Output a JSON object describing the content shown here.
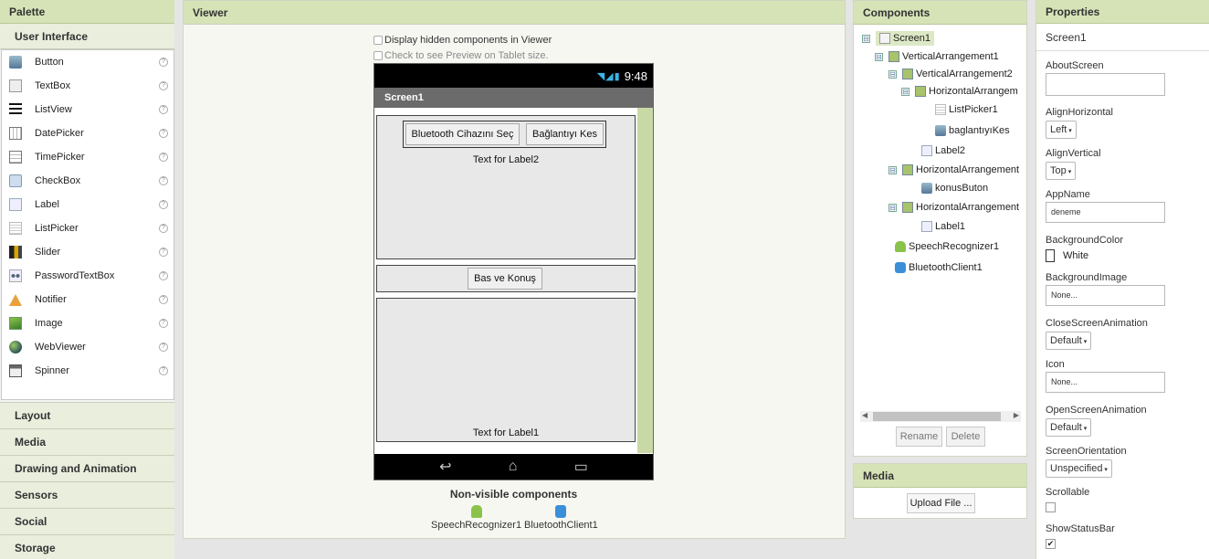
{
  "palette": {
    "title": "Palette",
    "open_category": "User Interface",
    "items": [
      {
        "label": "Button",
        "icon": "button-icon"
      },
      {
        "label": "TextBox",
        "icon": "textbox-icon"
      },
      {
        "label": "ListView",
        "icon": "listview-icon"
      },
      {
        "label": "DatePicker",
        "icon": "datepicker-icon"
      },
      {
        "label": "TimePicker",
        "icon": "timepicker-icon"
      },
      {
        "label": "CheckBox",
        "icon": "checkbox-icon"
      },
      {
        "label": "Label",
        "icon": "label-icon"
      },
      {
        "label": "ListPicker",
        "icon": "listpicker-icon"
      },
      {
        "label": "Slider",
        "icon": "slider-icon"
      },
      {
        "label": "PasswordTextBox",
        "icon": "password-icon"
      },
      {
        "label": "Notifier",
        "icon": "notifier-icon"
      },
      {
        "label": "Image",
        "icon": "image-icon"
      },
      {
        "label": "WebViewer",
        "icon": "webviewer-icon"
      },
      {
        "label": "Spinner",
        "icon": "spinner-icon"
      }
    ],
    "help_glyph": "?",
    "categories": [
      "Layout",
      "Media",
      "Drawing and Animation",
      "Sensors",
      "Social",
      "Storage"
    ]
  },
  "viewer": {
    "title": "Viewer",
    "opt_hidden": "Display hidden components in Viewer",
    "opt_tablet": "Check to see Preview on Tablet size.",
    "phone": {
      "time": "9:48",
      "screen_title": "Screen1",
      "btn_select": "Bluetooth Cihazını Seç",
      "btn_disconnect": "Bağlantıyı Kes",
      "label2": "Text for Label2",
      "btn_speak": "Bas ve Konuş",
      "label1": "Text for Label1"
    },
    "nonvisible_title": "Non-visible components",
    "nonvisible": [
      "SpeechRecognizer1",
      "BluetoothClient1"
    ]
  },
  "components": {
    "title": "Components",
    "tree": [
      {
        "label": "Screen1",
        "level": 0
      },
      {
        "label": "VerticalArrangement1",
        "level": 1
      },
      {
        "label": "VerticalArrangement2",
        "level": 2
      },
      {
        "label": "HorizontalArrangem",
        "level": 3
      },
      {
        "label": "ListPicker1",
        "level": 4
      },
      {
        "label": "baglantıyıKes",
        "level": 4
      },
      {
        "label": "Label2",
        "level": 3
      },
      {
        "label": "HorizontalArrangement",
        "level": 2
      },
      {
        "label": "konusButon",
        "level": 3
      },
      {
        "label": "HorizontalArrangement",
        "level": 2
      },
      {
        "label": "Label1",
        "level": 3
      },
      {
        "label": "SpeechRecognizer1",
        "level": 1
      },
      {
        "label": "BluetoothClient1",
        "level": 1
      }
    ],
    "toggle_glyph": "⊟",
    "rename": "Rename",
    "delete": "Delete"
  },
  "media": {
    "title": "Media",
    "upload": "Upload File ..."
  },
  "properties": {
    "title": "Properties",
    "screen": "Screen1",
    "about_label": "AboutScreen",
    "alignh_label": "AlignHorizontal",
    "alignh_value": "Left",
    "alignv_label": "AlignVertical",
    "alignv_value": "Top",
    "appname_label": "AppName",
    "appname_value": "deneme",
    "bgcolor_label": "BackgroundColor",
    "bgcolor_value": "White",
    "bgimage_label": "BackgroundImage",
    "bgimage_value": "None...",
    "closeanim_label": "CloseScreenAnimation",
    "closeanim_value": "Default",
    "icon_label": "Icon",
    "icon_value": "None...",
    "openanim_label": "OpenScreenAnimation",
    "openanim_value": "Default",
    "orientation_label": "ScreenOrientation",
    "orientation_value": "Unspecified",
    "scrollable_label": "Scrollable",
    "statusbar_label": "ShowStatusBar",
    "statusbar_check": "✔"
  }
}
